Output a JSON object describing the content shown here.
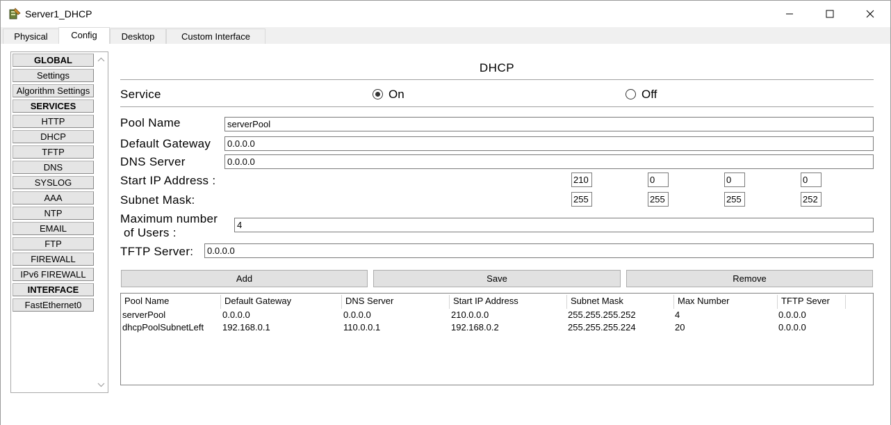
{
  "window": {
    "title": "Server1_DHCP"
  },
  "tabs": [
    {
      "label": "Physical"
    },
    {
      "label": "Config"
    },
    {
      "label": "Desktop"
    },
    {
      "label": "Custom Interface"
    }
  ],
  "sidebar": {
    "items": [
      {
        "label": "GLOBAL"
      },
      {
        "label": "Settings"
      },
      {
        "label": "Algorithm Settings"
      },
      {
        "label": "SERVICES"
      },
      {
        "label": "HTTP"
      },
      {
        "label": "DHCP"
      },
      {
        "label": "TFTP"
      },
      {
        "label": "DNS"
      },
      {
        "label": "SYSLOG"
      },
      {
        "label": "AAA"
      },
      {
        "label": "NTP"
      },
      {
        "label": "EMAIL"
      },
      {
        "label": "FTP"
      },
      {
        "label": "FIREWALL"
      },
      {
        "label": "IPv6 FIREWALL"
      },
      {
        "label": "INTERFACE"
      },
      {
        "label": "FastEthernet0"
      }
    ]
  },
  "dhcp": {
    "title": "DHCP",
    "service_label": "Service",
    "on_label": "On",
    "off_label": "Off",
    "service_state": "On",
    "pool_name_label": "Pool Name",
    "pool_name": "serverPool",
    "gateway_label": "Default Gateway",
    "gateway": "0.0.0.0",
    "dns_label": "DNS Server",
    "dns": "0.0.0.0",
    "start_ip_label": "Start IP Address :",
    "start_ip": [
      "210",
      "0",
      "0",
      "0"
    ],
    "mask_label": "Subnet Mask:",
    "mask": [
      "255",
      "255",
      "255",
      "252"
    ],
    "max_users_label_1": "Maximum number",
    "max_users_label_2": " of Users :",
    "max_users": "4",
    "tftp_label": "TFTP Server:",
    "tftp": "0.0.0.0",
    "add_label": "Add",
    "save_label": "Save",
    "remove_label": "Remove"
  },
  "table": {
    "headers": [
      "Pool Name",
      "Default Gateway",
      "DNS Server",
      "Start IP Address",
      "Subnet Mask",
      "Max Number",
      "TFTP Sever"
    ],
    "rows": [
      [
        "serverPool",
        "0.0.0.0",
        "0.0.0.0",
        "210.0.0.0",
        "255.255.255.252",
        "4",
        "0.0.0.0"
      ],
      [
        "dhcpPoolSubnetLeft",
        "192.168.0.1",
        "110.0.0.1",
        "192.168.0.2",
        "255.255.255.224",
        "20",
        "0.0.0.0"
      ]
    ]
  }
}
